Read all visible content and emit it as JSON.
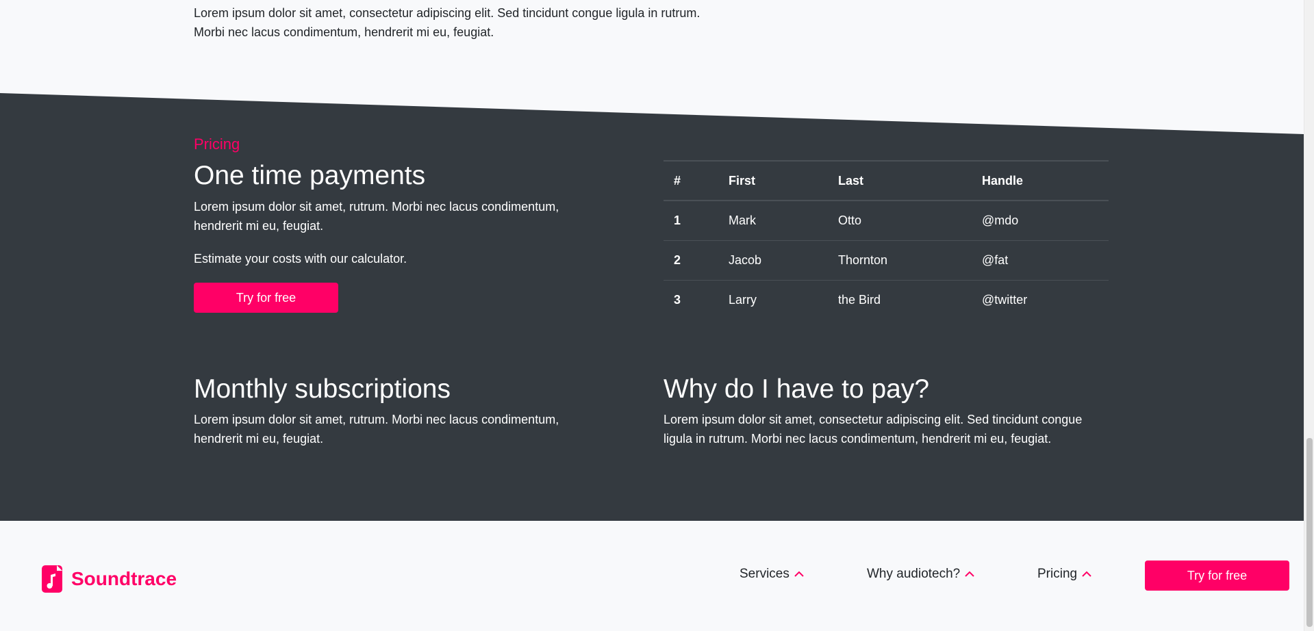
{
  "intro": {
    "text": "Lorem ipsum dolor sit amet, consectetur adipiscing elit. Sed tincidunt congue ligula in rutrum. Morbi nec lacus condimentum, hendrerit mi eu, feugiat."
  },
  "pricing": {
    "eyebrow": "Pricing",
    "title": "One time payments",
    "text": "Lorem ipsum dolor sit amet, rutrum. Morbi nec lacus condimentum, hendrerit mi eu, feugiat.",
    "calculator_text": "Estimate your costs with our calculator.",
    "cta_label": "Try for free"
  },
  "table": {
    "headers": [
      "#",
      "First",
      "Last",
      "Handle"
    ],
    "rows": [
      [
        "1",
        "Mark",
        "Otto",
        "@mdo"
      ],
      [
        "2",
        "Jacob",
        "Thornton",
        "@fat"
      ],
      [
        "3",
        "Larry",
        "the Bird",
        "@twitter"
      ]
    ]
  },
  "monthly": {
    "title": "Monthly subscriptions",
    "text": "Lorem ipsum dolor sit amet, rutrum. Morbi nec lacus condimentum, hendrerit mi eu, feugiat."
  },
  "why": {
    "title": "Why do I have to pay?",
    "text": "Lorem ipsum dolor sit amet, consectetur adipiscing elit. Sed tincidunt congue ligula in rutrum. Morbi nec lacus condimentum, hendrerit mi eu, feugiat."
  },
  "footer": {
    "brand": "Soundtrace",
    "brand_icon": "music-file-icon",
    "nav": [
      {
        "label": "Services",
        "icon": "chevron-up-icon"
      },
      {
        "label": "Why audiotech?",
        "icon": "chevron-up-icon"
      },
      {
        "label": "Pricing",
        "icon": "chevron-up-icon"
      }
    ],
    "cta_label": "Try for free"
  },
  "colors": {
    "accent": "#ff0066",
    "dark_section": "#343a40",
    "background": "#f8f9fb"
  }
}
